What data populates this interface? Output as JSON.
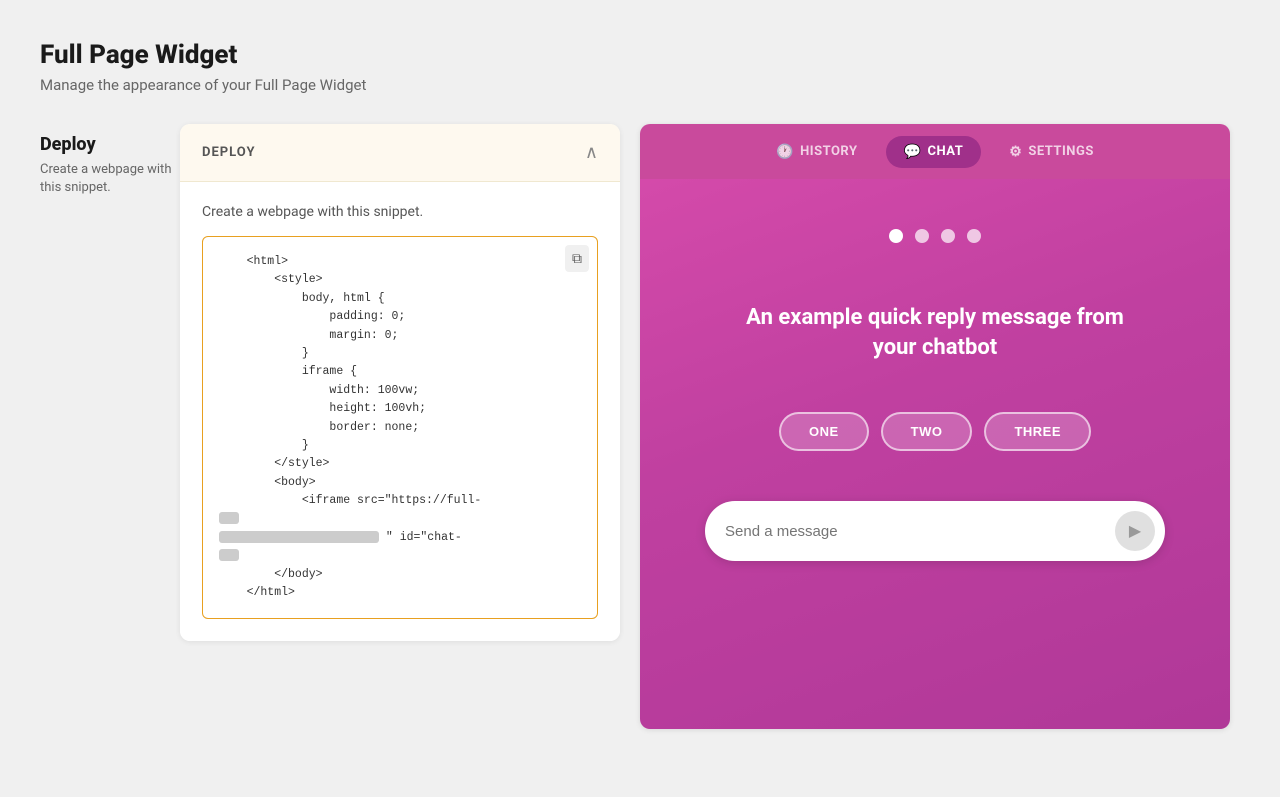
{
  "page": {
    "title": "Full Page Widget",
    "subtitle": "Manage the appearance of your Full Page Widget"
  },
  "sidebar": {
    "title": "Deploy",
    "description": "Create a webpage with this snippet."
  },
  "deploy_panel": {
    "label": "DEPLOY",
    "description": "Create a webpage with this snippet.",
    "copy_icon": "⧉",
    "code_lines": [
      "<html>",
      "    <style>",
      "        body, html {",
      "            padding: 0;",
      "            margin: 0;",
      "        }",
      "        iframe {",
      "            width: 100vw;",
      "            height: 100vh;",
      "            border: none;",
      "        }",
      "    </style>",
      "    <body>",
      "        <iframe src=\"https://full-",
      "",
      "",
      "    </body>",
      "</html>"
    ]
  },
  "preview": {
    "nav_tabs": [
      {
        "id": "history",
        "label": "HISTORY",
        "icon": "🕐"
      },
      {
        "id": "chat",
        "label": "CHAT",
        "icon": "💬"
      },
      {
        "id": "settings",
        "label": "SETTINGS",
        "icon": "⚙"
      }
    ],
    "active_tab": "chat",
    "dots": [
      {
        "active": true
      },
      {
        "active": false
      },
      {
        "active": false
      },
      {
        "active": false
      }
    ],
    "quick_reply_message": "An example quick reply message from your chatbot",
    "quick_reply_buttons": [
      {
        "label": "ONE"
      },
      {
        "label": "TWO"
      },
      {
        "label": "THREE"
      }
    ],
    "message_input_placeholder": "Send a message",
    "send_button_icon": "▶"
  }
}
